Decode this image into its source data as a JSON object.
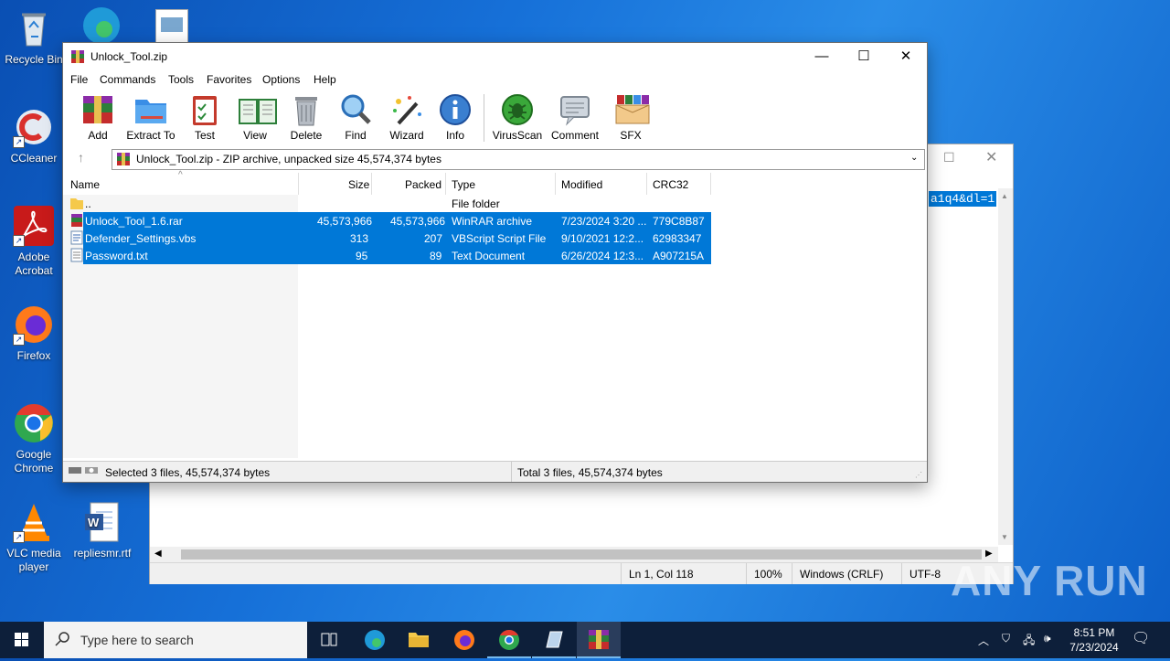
{
  "desktop": {
    "icons": [
      {
        "label": "Recycle Bin"
      },
      {
        "label": "CCleaner"
      },
      {
        "label": "Adobe Acrobat"
      },
      {
        "label": "Firefox"
      },
      {
        "label": "Google Chrome"
      },
      {
        "label": "VLC media player"
      },
      {
        "label": "repliesmr.rtf"
      }
    ]
  },
  "notepad": {
    "selected_text": "a1q4&dl=1",
    "status": {
      "position": "Ln 1, Col 118",
      "zoom": "100%",
      "line_endings": "Windows (CRLF)",
      "encoding": "UTF-8"
    }
  },
  "winrar": {
    "title": "Unlock_Tool.zip",
    "menu": [
      "File",
      "Commands",
      "Tools",
      "Favorites",
      "Options",
      "Help"
    ],
    "toolbar": [
      "Add",
      "Extract To",
      "Test",
      "View",
      "Delete",
      "Find",
      "Wizard",
      "Info",
      "VirusScan",
      "Comment",
      "SFX"
    ],
    "address": "Unlock_Tool.zip - ZIP archive, unpacked size 45,574,374 bytes",
    "columns": [
      "Name",
      "Size",
      "Packed",
      "Type",
      "Modified",
      "CRC32"
    ],
    "rows": [
      {
        "name": "..",
        "size": "",
        "packed": "",
        "type": "File folder",
        "modified": "",
        "crc": ""
      },
      {
        "name": "Unlock_Tool_1.6.rar",
        "size": "45,573,966",
        "packed": "45,573,966",
        "type": "WinRAR archive",
        "modified": "7/23/2024 3:20 ...",
        "crc": "779C8B87"
      },
      {
        "name": "Defender_Settings.vbs",
        "size": "313",
        "packed": "207",
        "type": "VBScript Script File",
        "modified": "9/10/2021 12:2...",
        "crc": "62983347"
      },
      {
        "name": "Password.txt",
        "size": "95",
        "packed": "89",
        "type": "Text Document",
        "modified": "6/26/2024 12:3...",
        "crc": "A907215A"
      }
    ],
    "status_left": "Selected 3 files, 45,574,374 bytes",
    "status_right": "Total 3 files, 45,574,374 bytes"
  },
  "taskbar": {
    "search_placeholder": "Type here to search",
    "time": "8:51 PM",
    "date": "7/23/2024"
  },
  "watermark": "ANY RUN"
}
